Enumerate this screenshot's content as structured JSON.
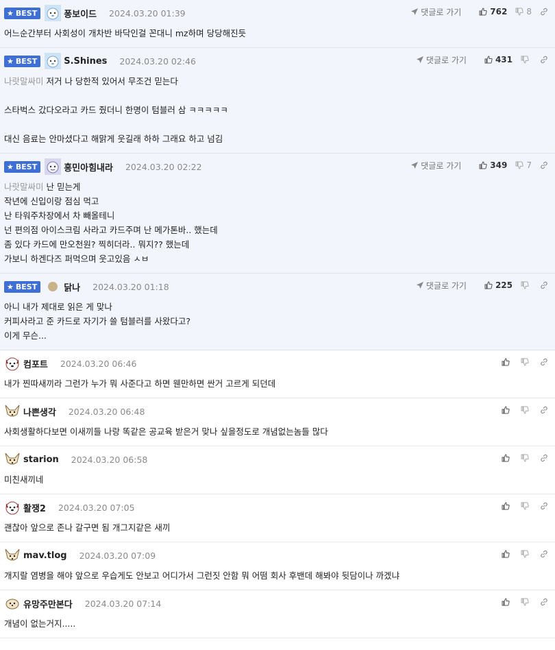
{
  "ui": {
    "best_label": "BEST",
    "reply_label": "댓글로 가기"
  },
  "comments": [
    {
      "nick": "퐁보이드",
      "date": "2024.03.20 01:39",
      "up": "762",
      "down": "8",
      "best": true,
      "avatar": "blue",
      "ref": "",
      "text": "어느순간부터 사회성이 개차반 바닥인걸 꼰대니 mz하며 당당해진듯"
    },
    {
      "nick": "S.Shines",
      "date": "2024.03.20 02:46",
      "up": "431",
      "down": "",
      "best": true,
      "avatar": "blue",
      "ref": "나랏말싸미",
      "text": " 저거 나 당한적 있어서 무조건 믿는다\n\n스타벅스 갔다오라고 카드 줬더니 한명이 텀블러 삼 ㅋㅋㅋㅋㅋ\n\n대신 음료는 안마셨다고 해맑게 웃길래 하하 그래요 하고 넘김"
    },
    {
      "nick": "흥민아힘내라",
      "date": "2024.03.20 02:22",
      "up": "349",
      "down": "7",
      "best": true,
      "avatar": "purple",
      "ref": "나랏말싸미",
      "text": " 난 믿는게\n작년에 신입이랑 점심 먹고\n난 타워주차장에서 차 빼올테니\n넌 편의점 아이스크림 사라고 카드주며 난 메가톤바.. 했는데\n좀 있다 카드에 만오천원? 찍히더라.. 뭐지?? 했는데\n가보니 하겐다즈 퍼먹으며 웃고있음 ㅅㅂ"
    },
    {
      "nick": "닭나",
      "date": "2024.03.20 01:18",
      "up": "225",
      "down": "",
      "best": true,
      "avatar": "beige",
      "ref": "",
      "text": "아니 내가 제대로 읽은 게 맞나\n커피사라고 준 카드로 자기가 쓸 텀블러를 사왔다고?\n이게 무슨..."
    },
    {
      "nick": "컴포트",
      "date": "2024.03.20 06:46",
      "up": "",
      "down": "",
      "best": false,
      "avatar": "dog",
      "ref": "",
      "text": "내가 찐따새끼라 그런가 누가 뭐 사준다고 하면 웬만하면 싼거 고르게 되던데"
    },
    {
      "nick": "나쁜생각",
      "date": "2024.03.20 06:48",
      "up": "",
      "down": "",
      "best": false,
      "avatar": "fox",
      "ref": "",
      "text": "사회생활하다보면 이새끼들 나랑 똑같은 공교육 받은거 맞나 싶을정도로 개념없는놈들 많다"
    },
    {
      "nick": "starion",
      "date": "2024.03.20 06:58",
      "up": "",
      "down": "",
      "best": false,
      "avatar": "fox",
      "ref": "",
      "text": "미친새끼네"
    },
    {
      "nick": "활쟁2",
      "date": "2024.03.20 07:05",
      "up": "",
      "down": "",
      "best": false,
      "avatar": "dog",
      "ref": "",
      "text": "괜찮아 앞으로 존나 갈구면 됨 개그지같은 새끼"
    },
    {
      "nick": "mav.tlog",
      "date": "2024.03.20 07:09",
      "up": "",
      "down": "",
      "best": false,
      "avatar": "fox",
      "ref": "",
      "text": "개지랄 염병을 해야 앞으로 우습게도 안보고 어디가서 그런짓 안함 뭐 어떰 회사 후밴데 해봐야 뒷담이나 까겠냐"
    },
    {
      "nick": "유망주만본다",
      "date": "2024.03.20 07:14",
      "up": "",
      "down": "",
      "best": false,
      "avatar": "pup",
      "ref": "",
      "text": "개념이 없는거지....."
    }
  ]
}
